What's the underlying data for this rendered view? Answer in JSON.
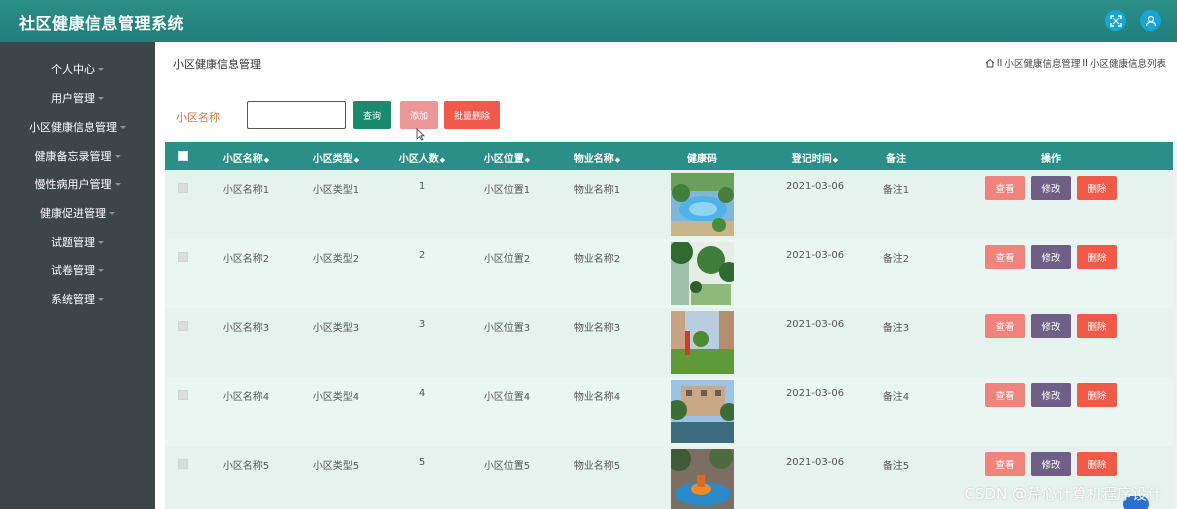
{
  "header": {
    "title": "社区健康信息管理系统",
    "icon_left": "fullscreen-icon",
    "icon_right": "user-icon"
  },
  "sidebar": {
    "items": [
      {
        "label": "个人中心"
      },
      {
        "label": "用户管理"
      },
      {
        "label": "小区健康信息管理"
      },
      {
        "label": "健康备忘录管理"
      },
      {
        "label": "慢性病用户管理"
      },
      {
        "label": "健康促进管理"
      },
      {
        "label": "试题管理"
      },
      {
        "label": "试卷管理"
      },
      {
        "label": "系统管理"
      }
    ]
  },
  "page": {
    "title": "小区健康信息管理",
    "breadcrumb": [
      "小区健康信息管理",
      "小区健康信息列表"
    ],
    "breadcrumb_sep": "II"
  },
  "search": {
    "label": "小区名称",
    "value": "",
    "query": "查询",
    "add": "添加",
    "batch_delete": "批量删除"
  },
  "table": {
    "headers": {
      "name": "小区名称",
      "type": "小区类型",
      "people": "小区人数",
      "location": "小区位置",
      "property": "物业名称",
      "code": "健康码",
      "time": "登记时间",
      "remark": "备注",
      "action": "操作"
    },
    "actions": {
      "view": "查看",
      "edit": "修改",
      "delete": "删除"
    },
    "rows": [
      {
        "name": "小区名称1",
        "type": "小区类型1",
        "people": "1",
        "location": "小区位置1",
        "property": "物业名称1",
        "time": "2021-03-06",
        "remark": "备注1"
      },
      {
        "name": "小区名称2",
        "type": "小区类型2",
        "people": "2",
        "location": "小区位置2",
        "property": "物业名称2",
        "time": "2021-03-06",
        "remark": "备注2"
      },
      {
        "name": "小区名称3",
        "type": "小区类型3",
        "people": "3",
        "location": "小区位置3",
        "property": "物业名称3",
        "time": "2021-03-06",
        "remark": "备注3"
      },
      {
        "name": "小区名称4",
        "type": "小区类型4",
        "people": "4",
        "location": "小区位置4",
        "property": "物业名称4",
        "time": "2021-03-06",
        "remark": "备注4"
      },
      {
        "name": "小区名称5",
        "type": "小区类型5",
        "people": "5",
        "location": "小区位置5",
        "property": "物业名称5",
        "time": "2021-03-06",
        "remark": "备注5"
      }
    ]
  },
  "colors": {
    "header": "#2b8f88",
    "sidebar": "#3e4549",
    "query": "#1a8a6d",
    "add": "#ec9797",
    "batch": "#f05a4d",
    "view": "#f0847d",
    "edit": "#6f5f86",
    "delete": "#f15a48"
  },
  "watermark": "CSDN @芹心计算机程序设计"
}
